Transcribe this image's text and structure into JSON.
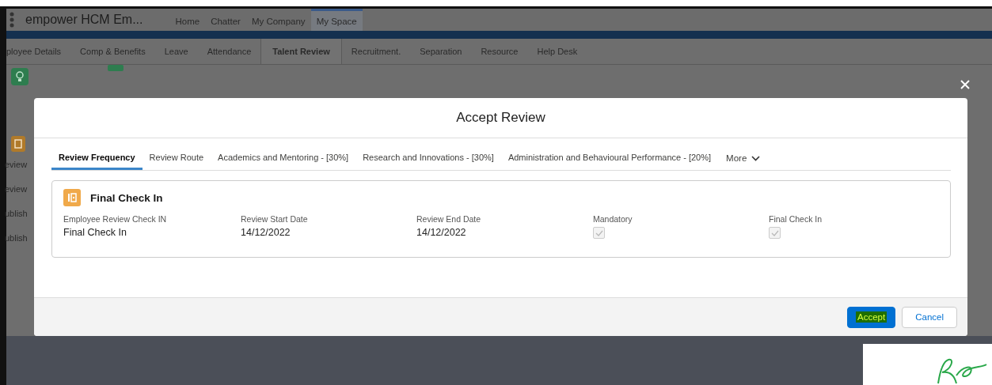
{
  "app": {
    "name": "empower HCM Em...",
    "nav": [
      {
        "label": "Home",
        "selected": false
      },
      {
        "label": "Chatter",
        "selected": false
      },
      {
        "label": "My Company",
        "selected": false
      },
      {
        "label": "My Space",
        "selected": true
      }
    ]
  },
  "tabs": [
    {
      "label": "ployee Details",
      "selected": false
    },
    {
      "label": "Comp & Benefits",
      "selected": false
    },
    {
      "label": "Leave",
      "selected": false
    },
    {
      "label": "Attendance",
      "selected": false
    },
    {
      "label": "Talent Review",
      "selected": true
    },
    {
      "label": "Recruitment.",
      "selected": false
    },
    {
      "label": "Separation",
      "selected": false
    },
    {
      "label": "Resource",
      "selected": false
    },
    {
      "label": "Help Desk",
      "selected": false
    }
  ],
  "background_items": [
    "eview",
    "eview",
    "ublish",
    "ublish"
  ],
  "modal": {
    "title": "Accept Review",
    "tabs": [
      {
        "label": "Review Frequency",
        "selected": true
      },
      {
        "label": "Review Route",
        "selected": false
      },
      {
        "label": "Academics and Mentoring - [30%]",
        "selected": false
      },
      {
        "label": "Research and Innovations - [30%]",
        "selected": false
      },
      {
        "label": "Administration and Behavioural Performance - [20%]",
        "selected": false
      }
    ],
    "more": "More",
    "card": {
      "title": "Final Check In",
      "fields": [
        {
          "kind": "text",
          "label": "Employee Review Check IN",
          "value": "Final Check In"
        },
        {
          "kind": "text",
          "label": "Review Start Date",
          "value": "14/12/2022"
        },
        {
          "kind": "text",
          "label": "Review End Date",
          "value": "14/12/2022"
        },
        {
          "kind": "checkbox",
          "label": "Mandatory",
          "checked": true,
          "disabled": true
        },
        {
          "kind": "checkbox",
          "label": "Final Check In",
          "checked": true,
          "disabled": true
        }
      ]
    },
    "buttons": [
      {
        "label": "Accept",
        "kind": "brand",
        "highlighted": true
      },
      {
        "label": "Cancel",
        "kind": "neutral",
        "highlighted": false
      }
    ]
  }
}
